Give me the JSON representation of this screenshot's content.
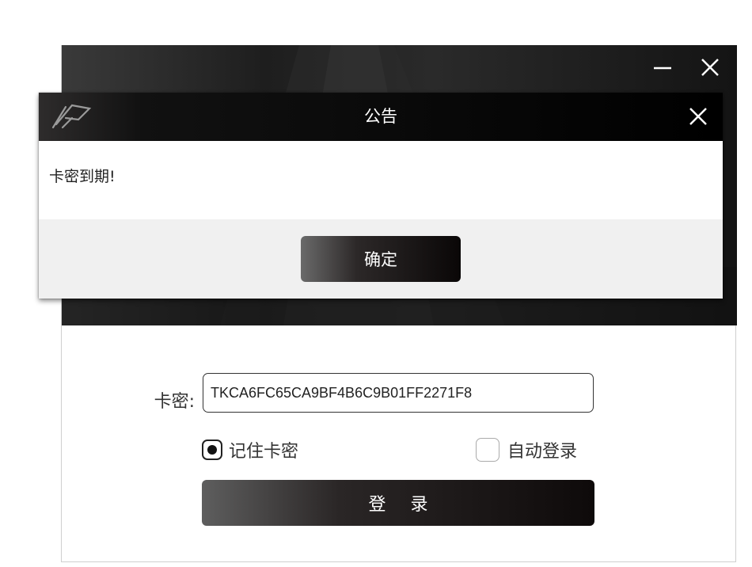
{
  "main_window": {
    "login_form": {
      "card_label": "卡密:",
      "card_value": "TKCA6FC65CA9BF4B6C9B01FF2271F8",
      "remember_label": "记住卡密",
      "remember_checked": true,
      "auto_login_label": "自动登录",
      "auto_login_checked": false,
      "login_button": "登 录"
    },
    "icons": {
      "minimize": "minimize-icon",
      "close": "close-icon"
    }
  },
  "dialog": {
    "title": "公告",
    "message": "卡密到期!",
    "ok_button": "确定",
    "icons": {
      "logo": "app-logo-icon",
      "close": "close-icon"
    }
  },
  "colors": {
    "header_dark": "#111111",
    "button_dark": "#0e0a0a",
    "footer_bg": "#f0f0f0"
  }
}
